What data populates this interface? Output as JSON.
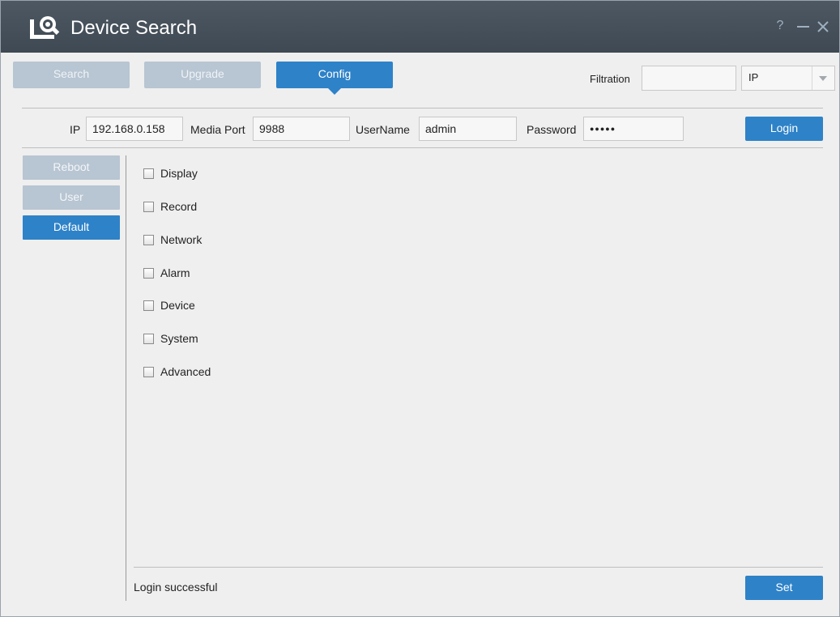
{
  "window": {
    "title": "Device Search",
    "controls": {
      "help": "?",
      "minimize": "minimize-icon",
      "close": "close-icon"
    }
  },
  "tabs": [
    {
      "label": "Search",
      "state": "disabled"
    },
    {
      "label": "Upgrade",
      "state": "disabled"
    },
    {
      "label": "Config",
      "state": "active"
    }
  ],
  "filter": {
    "label": "Filtration",
    "value": "",
    "type_select": {
      "selected": "IP"
    }
  },
  "login_bar": {
    "ip_label": "IP",
    "ip_value": "192.168.0.158",
    "port_label": "Media Port",
    "port_value": "9988",
    "username_label": "UserName",
    "username_value": "admin",
    "password_label": "Password",
    "password_value": "●●●●●",
    "login_button": "Login"
  },
  "sidebar": {
    "items": [
      {
        "label": "Reboot",
        "state": "disabled"
      },
      {
        "label": "User",
        "state": "disabled"
      },
      {
        "label": "Default",
        "state": "active"
      }
    ]
  },
  "default_options": [
    {
      "label": "Display",
      "checked": false
    },
    {
      "label": "Record",
      "checked": false
    },
    {
      "label": "Network",
      "checked": false
    },
    {
      "label": "Alarm",
      "checked": false
    },
    {
      "label": "Device",
      "checked": false
    },
    {
      "label": "System",
      "checked": false
    },
    {
      "label": "Advanced",
      "checked": false
    }
  ],
  "footer": {
    "status": "Login successful",
    "set_button": "Set"
  },
  "colors": {
    "titlebar": "#444e58",
    "accent": "#2e82c8",
    "disabled": "#b8c5d2"
  }
}
